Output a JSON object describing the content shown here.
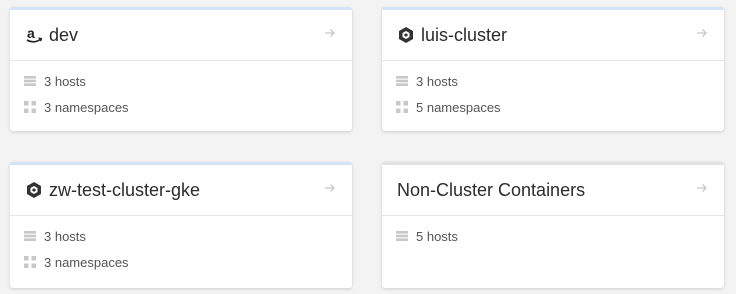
{
  "colors": {
    "accent_top": "#d4e3f7",
    "plain_top": "#e2e2e2",
    "title": "#2b2b2b",
    "text_muted": "#555555",
    "icon_muted": "#c8c8c8"
  },
  "clusters": [
    {
      "name": "dev",
      "provider_icon": "amazon-icon",
      "hosts": "3 hosts",
      "namespaces": "3 namespaces"
    },
    {
      "name": "luis-cluster",
      "provider_icon": "gke-icon",
      "hosts": "3 hosts",
      "namespaces": "5 namespaces"
    },
    {
      "name": "zw-test-cluster-gke",
      "provider_icon": "gke-icon",
      "hosts": "3 hosts",
      "namespaces": "3 namespaces"
    },
    {
      "name": "Non-Cluster Containers",
      "provider_icon": "",
      "hosts": "5 hosts"
    }
  ]
}
